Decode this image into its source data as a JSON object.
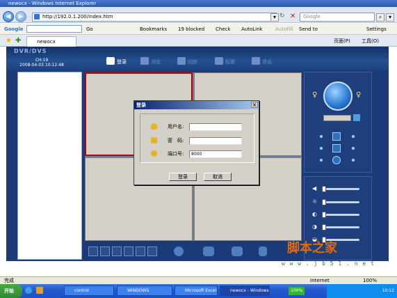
{
  "browser": {
    "title": "newocx - Windows Internet Explorer",
    "url": "http://192.0.1.200/index.htm",
    "search_placeholder": "Google",
    "tab_label": "newocx",
    "toolbar": {
      "google": "Google",
      "go": "Go",
      "bookmarks": "Bookmarks",
      "blocked": "19 blocked",
      "check": "Check",
      "autolink": "AutoLink",
      "autofill": "AutoFill",
      "sendto": "Send to",
      "settings": "Settings"
    },
    "page_menu": "页面(P)",
    "tools_menu": "工具(O)",
    "status_left": "完成",
    "status_zone": "Internet",
    "zoom": "100%"
  },
  "app": {
    "logo": "DVR/DVS",
    "channel": "CH:19",
    "datetime": "2008-04-03 10:12:48",
    "nav": [
      {
        "label": "登录"
      },
      {
        "label": "浏览"
      },
      {
        "label": "回放"
      },
      {
        "label": "配置"
      },
      {
        "label": "退出"
      }
    ]
  },
  "dialog": {
    "title": "登录",
    "username_label": "用户名:",
    "password_label": "密　码:",
    "port_label": "端口号:",
    "username_value": "",
    "password_value": "",
    "port_value": "8000",
    "ok_label": "登录",
    "cancel_label": "取消"
  },
  "taskbar": {
    "start": "开始",
    "items": [
      "control",
      "WINDOWS",
      "Microsoft Excel - ...",
      "newocx - Windows ..."
    ],
    "battery": "100%",
    "time": "10:12"
  },
  "watermark": {
    "text": "脚本之家",
    "url": "w w w . j b 5 1 . n e t"
  }
}
